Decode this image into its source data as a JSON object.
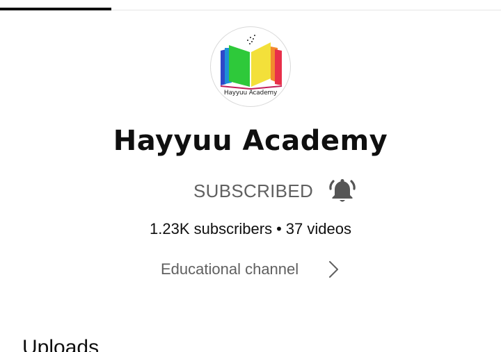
{
  "channel": {
    "name": "Hayyuu Academy",
    "avatar_caption": "Hayyuu Academy",
    "subscription_status": "SUBSCRIBED",
    "subscribers": "1.23K subscribers",
    "separator": "•",
    "videos": "37 videos",
    "about": "Educational channel"
  },
  "section": {
    "title": "Uploads"
  },
  "icons": {
    "notification": "bell-icon",
    "about_expand": "chevron-right-icon",
    "logo": "book-logo"
  },
  "colors": {
    "text_primary": "#0f0f0f",
    "text_secondary": "#606060",
    "bell": "#555555",
    "book_blue": "#2f47c9",
    "book_green": "#2ec93a",
    "book_yellow": "#f3e03a",
    "book_red": "#e8304a",
    "book_orange": "#f28a2e"
  }
}
